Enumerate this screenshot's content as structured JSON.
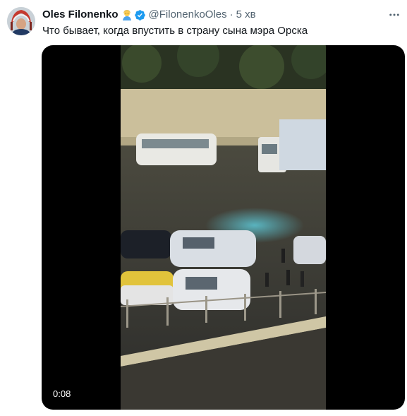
{
  "author": {
    "display_name": "Oles Filonenko",
    "emoji_icon": "person-emoji-icon",
    "verified_icon": "verified-badge-icon",
    "handle": "@FilonenkoOles",
    "separator": "·",
    "timestamp": "5 хв"
  },
  "tweet": {
    "text": "Что бывает, когда впустить в страну сына мэра Орска"
  },
  "media": {
    "type": "video",
    "duration": "0:08"
  },
  "icons": {
    "more": "more-options-icon"
  },
  "colors": {
    "text_primary": "#0f1419",
    "text_secondary": "#536471",
    "verified_blue": "#1d9bf0"
  }
}
